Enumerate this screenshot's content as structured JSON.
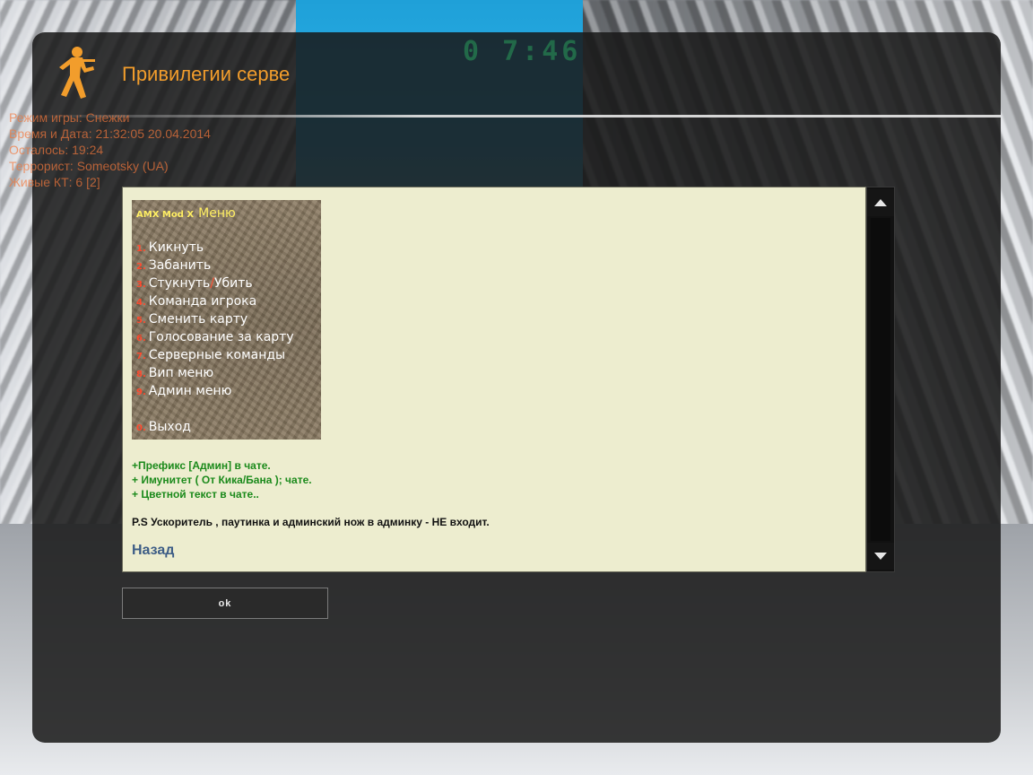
{
  "dialog": {
    "title": "Привилегии серве",
    "ok_label": "ok"
  },
  "hud": {
    "lines": [
      "Режим игры: Снежки",
      "Время и Дата: 21:32:05 20.04.2014",
      "Осталось: 19:24",
      "Террорист: Someotsky (UA)",
      "Живые КТ: 6 [2]"
    ],
    "timer": "0 7:46"
  },
  "amx_menu": {
    "brand": "AMX Mod X",
    "menu_word": "Меню",
    "items": [
      {
        "num": "1.",
        "label": "Кикнуть"
      },
      {
        "num": "2.",
        "label": "Забанить"
      },
      {
        "num": "3.",
        "label_a": "Стукнуть",
        "slash": "/",
        "label_b": "Убить"
      },
      {
        "num": "4.",
        "label": "Команда игрока"
      },
      {
        "num": "5.",
        "label": "Сменить карту"
      },
      {
        "num": "6.",
        "label": "Голосование за карту"
      },
      {
        "num": "7.",
        "label": "Серверные команды"
      },
      {
        "num": "8.",
        "label": "Вип меню"
      },
      {
        "num": "9.",
        "label": "Админ меню"
      }
    ],
    "exit": {
      "num": "0.",
      "label": "Выход"
    }
  },
  "perks": [
    "+Префикс [Админ] в чате.",
    "+ Имунитет ( От Кика/Бана ); чате.",
    "+ Цветной текст в чате.."
  ],
  "note": "P.S Ускоритель , паутинка и админский нож в админку - НЕ входит.",
  "back_label": "Назад",
  "colors": {
    "title": "#f29d2c",
    "panel_bg": "#ededcf",
    "perk_text": "#1b8a1b",
    "link": "#3d5d86",
    "amx_accent": "#ffef63",
    "amx_number": "#ff4a2e"
  }
}
